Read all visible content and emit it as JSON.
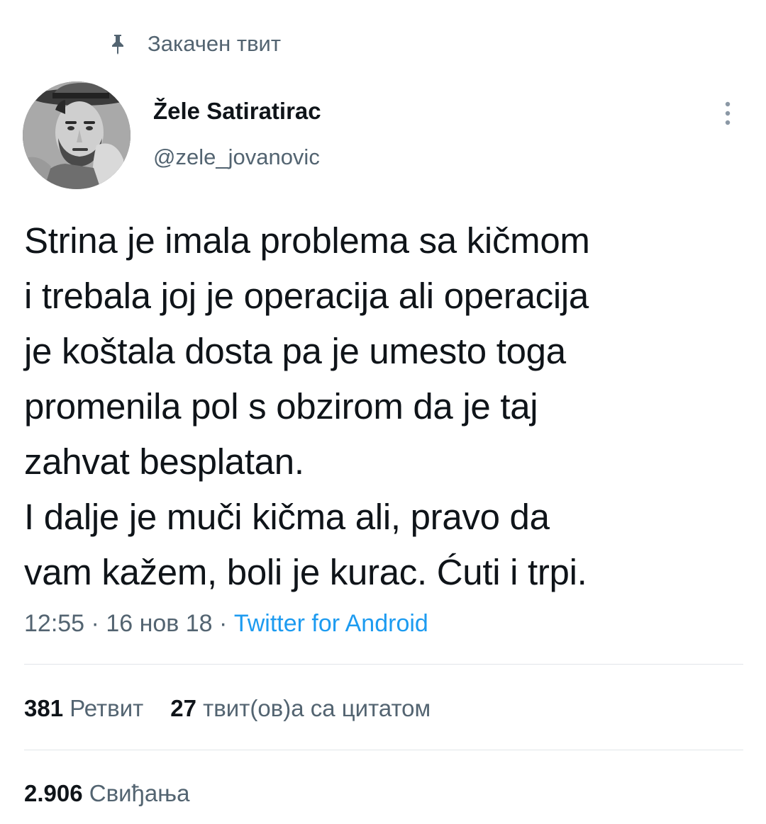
{
  "pinned": {
    "icon": "pin-icon",
    "label": "Закачен твит"
  },
  "author": {
    "avatar": "avatar",
    "display_name": "Žele Satiratirac",
    "handle": "@zele_jovanovic"
  },
  "more_icon": "more-vertical-icon",
  "tweet": {
    "text": "Strina je imala problema sa kičmom\ni trebala joj je operacija ali operacija\nje koštala dosta pa je umesto toga\npromenila pol s obzirom da je taj\nzahvat besplatan.\nI dalje je muči kičma ali, pravo da\nvam kažem, boli je kurac. Ćuti i trpi."
  },
  "meta": {
    "time": "12:55",
    "separator": " · ",
    "date": "16 нов 18",
    "source": "Twitter for Android"
  },
  "stats": {
    "retweets_count": "381",
    "retweets_label": " Ретвит",
    "quotes_count": "27",
    "quotes_label": " твит(ов)а са цитатом",
    "likes_count": "2.906",
    "likes_label": " Свиђања"
  },
  "colors": {
    "text_primary": "#0f1419",
    "text_secondary": "#536471",
    "link": "#1d9bf0",
    "divider": "#e1e5e9"
  }
}
